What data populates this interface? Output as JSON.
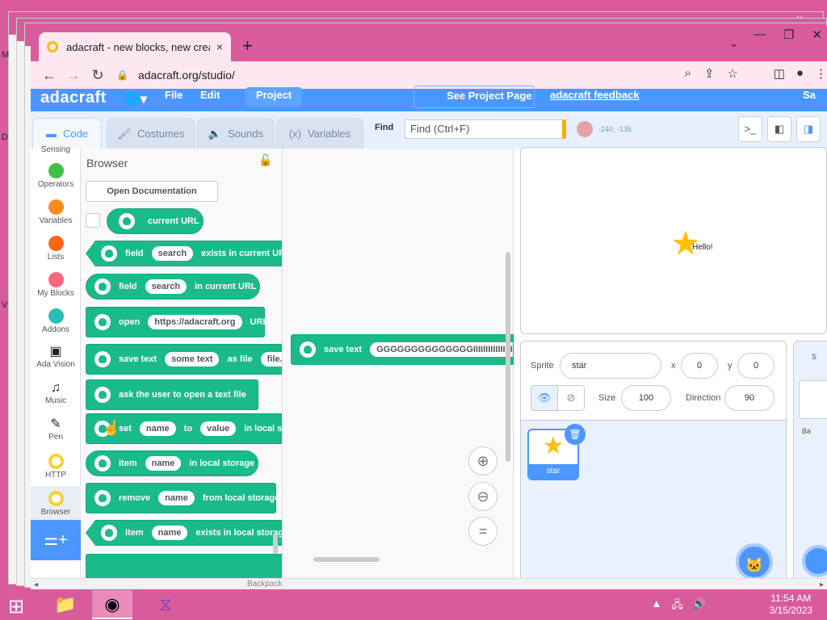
{
  "desktop": {
    "letters": [
      "M",
      "D",
      "V"
    ]
  },
  "browser": {
    "tab_title": "adacraft - new blocks, new creati",
    "tab_close": "×",
    "new_tab": "+",
    "url": "adacraft.org/studio/",
    "window_controls": [
      "—",
      "❐",
      "✕"
    ]
  },
  "menubar": {
    "logo": "adacraft",
    "file": "File",
    "edit": "Edit",
    "project": "Project",
    "see_project_page": "See Project Page",
    "feedback": "adacraft feedback",
    "sa": "Sa"
  },
  "tabs": {
    "code": "Code",
    "costumes": "Costumes",
    "sounds": "Sounds",
    "variables": "Variables"
  },
  "find": {
    "label": "Find",
    "placeholder": "Find (Ctrl+F)",
    "coords": "-240, -135"
  },
  "categories": [
    {
      "label": "Sensing",
      "color": "#5cb1d6"
    },
    {
      "label": "Operators",
      "color": "#40bf4a"
    },
    {
      "label": "Variables",
      "color": "#ff8c1a"
    },
    {
      "label": "Lists",
      "color": "#ff661a"
    },
    {
      "label": "My Blocks",
      "color": "#ff6680"
    },
    {
      "label": "Addons",
      "color": "#29beb8"
    },
    {
      "label": "Ada Vision",
      "icon": "▣"
    },
    {
      "label": "Music",
      "icon": "♫"
    },
    {
      "label": "Pen",
      "icon": "✎"
    },
    {
      "label": "HTTP",
      "color": "#f7d22d"
    },
    {
      "label": "Browser",
      "color": "#f7d22d"
    }
  ],
  "flyout": {
    "title": "Browser",
    "open_docs": "Open Documentation",
    "blocks": {
      "current_url": "current URL",
      "field_exists": {
        "a": "field",
        "pill": "search",
        "b": "exists in current URL"
      },
      "field_in": {
        "a": "field",
        "pill": "search",
        "b": "in current URL"
      },
      "open_url": {
        "a": "open",
        "pill": "https://adacraft.org",
        "b": "URL"
      },
      "save_text": {
        "a": "save text",
        "pill": "some text",
        "b": "as file",
        "pill2": "file.txt"
      },
      "ask_open": "ask the user to open a text file",
      "set_local": {
        "a": "set",
        "pill": "name",
        "b": "to",
        "pill2": "value",
        "c": "in local storage"
      },
      "item_local": {
        "a": "item",
        "pill": "name",
        "b": "in local storage"
      },
      "remove_local": {
        "a": "remove",
        "pill": "name",
        "b": "from local storage"
      },
      "item_exists": {
        "a": "item",
        "pill": "name",
        "b": "exists in local storage"
      }
    }
  },
  "script": {
    "block_label": "save text",
    "block_value": "GGGGGGGGGGGGGGIIIIIIIIIIIIIIIIIIIIIIIII"
  },
  "stage": {
    "speech": "Hello!"
  },
  "sprite": {
    "label": "Sprite",
    "name": "star",
    "x_label": "x",
    "x": "0",
    "y_label": "y",
    "y": "0",
    "size_label": "Size",
    "size": "100",
    "direction_label": "Direction",
    "direction": "90",
    "card_name": "star"
  },
  "stage_panel": {
    "s": "S",
    "label": "Ba"
  },
  "bottom_bar": {
    "backpack": "Backpack"
  },
  "taskbar": {
    "time": "11:54 AM",
    "date": "3/15/2023"
  },
  "colors": {
    "accent": "#4c97ff",
    "block": "#1aba8a",
    "desktop": "#d85c9c"
  }
}
